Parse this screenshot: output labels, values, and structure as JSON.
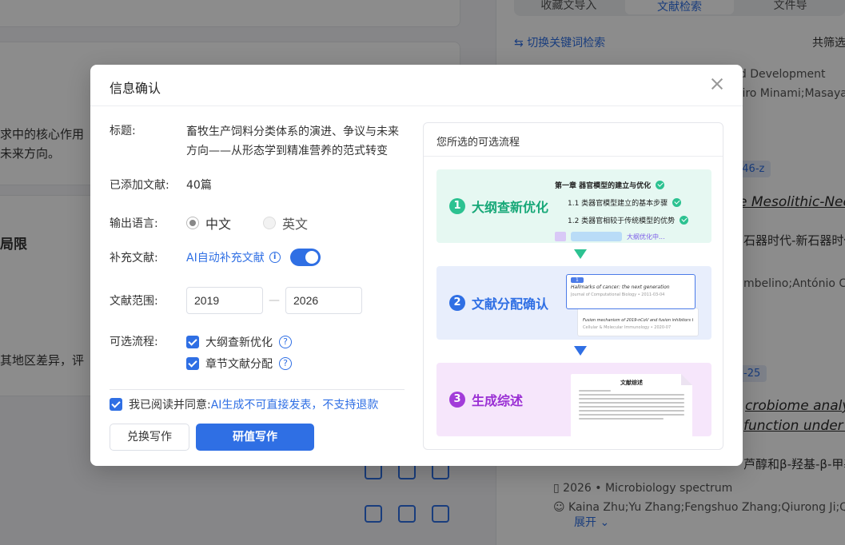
{
  "background": {
    "left_text_1": "求中的核心作用",
    "left_text_2": "未来方向。",
    "left_heading": "局限",
    "left_text_3": "其地区差异，评",
    "tabs": [
      "收藏文导入",
      "文献检索",
      "文件导"
    ],
    "switch_link": "切换关键词检索",
    "total_filter": "共筛选",
    "right_text_1": "nd Development",
    "right_text_2": "ojiro Minami;Masayas",
    "chip_1": "346-z",
    "italic_1": "e Mesolithic-Neoli",
    "right_text_3": "石器时代-新石器时代",
    "right_text_4": "mbelino;António Car",
    "chip_2": "-25",
    "italic_2": "crobiome analysis",
    "italic_3": "function under di",
    "right_text_5": "芦醇和β-羟基-β-甲基",
    "year_journal": "2026  •  Microbiology spectrum",
    "authors": "Kaina Zhu;Yu Zhang;Fengshuo Zhang;Qiurong Ji;Quyan",
    "expand": "展开"
  },
  "modal": {
    "title": "信息确认",
    "fields": {
      "title_label": "标题:",
      "title_value": "畜牧生产饲料分类体系的演进、争议与未来方向——从形态学到精准营养的范式转变",
      "added_label": "已添加文献:",
      "added_value": "40篇",
      "lang_label": "输出语言:",
      "lang_cn": "中文",
      "lang_en": "英文",
      "supp_label": "补充文献:",
      "supp_value": "AI自动补充文献",
      "range_label": "文献范围:",
      "range_from": "2019",
      "range_to": "2026",
      "flow_label": "可选流程:",
      "flow_1": "大纲查新优化",
      "flow_2": "章节文献分配"
    },
    "agree_prefix": "我已阅读并同意:",
    "agree_link": "AI生成不可直接发表，不支持退款",
    "btn_redeem": "兑换写作",
    "btn_write": "研值写作",
    "flow_panel": {
      "title": "您所选的可选流程",
      "steps": [
        {
          "num": "1",
          "name": "大纲查新优化"
        },
        {
          "num": "2",
          "name": "文献分配确认"
        },
        {
          "num": "3",
          "name": "生成综述"
        }
      ],
      "step1_chapter": "第一章   器官模型的建立与优化",
      "step1_sub1": "1.1   类器官模型建立的基本步骤",
      "step1_sub2": "1.2   类器官相较于传统模型的优势",
      "step1_ai": "大纲优化中...",
      "step2_tag": "1",
      "step2_card1": "Hallmarks of cancer: the next generation",
      "step2_card1_meta": "Journal of Computational Biology  •  2011-03-04",
      "step2_card2": "Fusion mechanism of 2019-nCoV and fusion inhibitors targeting HR1 domain in spike protein",
      "step2_card2_meta": "Cellular & Molecular Immunology  •  2020-07",
      "step3_doc_title": "文献综述"
    }
  }
}
